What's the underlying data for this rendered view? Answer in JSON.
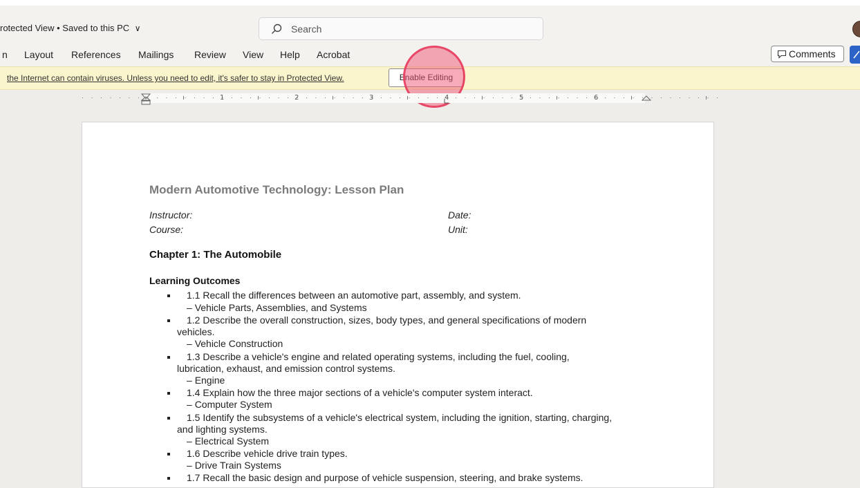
{
  "titlebar": {
    "doc_status": "rotected View • Saved to this PC",
    "chevron": "∨",
    "search_placeholder": "Search"
  },
  "ribbon": {
    "tabs": [
      "n",
      "Layout",
      "References",
      "Mailings",
      "Review",
      "View",
      "Help",
      "Acrobat"
    ],
    "comments_label": "Comments"
  },
  "infobar": {
    "message": "the Internet can contain viruses. Unless you need to edit, it's safer to stay in Protected View.",
    "enable_button": "Enable Editing"
  },
  "ruler": {
    "numbers": [
      "1",
      "2",
      "3",
      "4",
      "5",
      "6"
    ]
  },
  "document": {
    "title": "Modern Automotive Technology: Lesson Plan",
    "instructor_label": "Instructor:",
    "date_label": "Date:",
    "course_label": "Course:",
    "unit_label": "Unit:",
    "chapter": "Chapter 1: The Automobile",
    "outcomes_heading": "Learning Outcomes",
    "outcomes": [
      {
        "lines": [
          "1.1 Recall the differences between an automotive part, assembly, and system."
        ],
        "topic": "Vehicle Parts, Assemblies, and Systems"
      },
      {
        "lines": [
          "1.2 Describe the overall construction, sizes, body types, and general specifications of modern",
          "vehicles."
        ],
        "topic": "Vehicle Construction"
      },
      {
        "lines": [
          "1.3 Describe a vehicle's engine and related operating systems, including the fuel, cooling,",
          "lubrication, exhaust, and emission control systems."
        ],
        "topic": "Engine"
      },
      {
        "lines": [
          "1.4 Explain how the three major sections of a vehicle's computer system interact."
        ],
        "topic": "Computer System"
      },
      {
        "lines": [
          "1.5 Identify the subsystems of a vehicle's electrical system, including the ignition, starting, charging,",
          "and lighting systems."
        ],
        "topic": "Electrical System"
      },
      {
        "lines": [
          "1.6 Describe vehicle drive train types."
        ],
        "topic": "Drive Train Systems"
      },
      {
        "lines": [
          "1.7 Recall the basic design and purpose of vehicle suspension, steering, and brake systems."
        ],
        "topic": ""
      }
    ]
  },
  "colors": {
    "infobar_bg": "#fbf5cd",
    "highlight": "#ef5573",
    "accent": "#2b63c6"
  }
}
